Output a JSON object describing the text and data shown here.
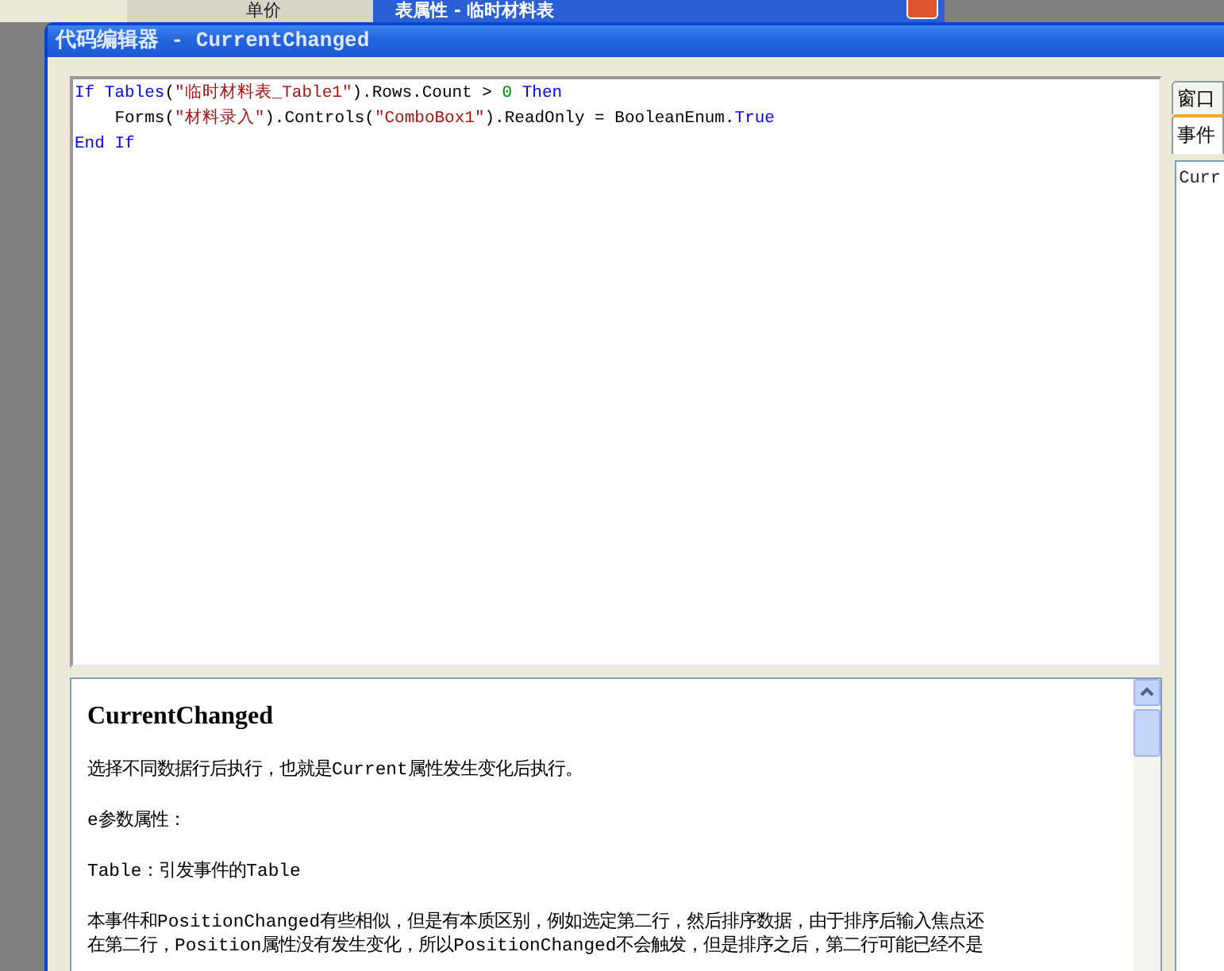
{
  "background": {
    "column_header": "单价",
    "window_title": "表属性 - 临时材料表"
  },
  "window": {
    "title": "代码编辑器 - CurrentChanged"
  },
  "code": [
    [
      {
        "kind": "keyword",
        "text": "If"
      },
      {
        "kind": "keyword",
        "text": "Tables",
        "space_before": true
      },
      {
        "kind": "plain",
        "text": "("
      },
      {
        "kind": "string",
        "text": "\"临时材料表_Table1\""
      },
      {
        "kind": "plain",
        "text": ").Rows.Count > "
      },
      {
        "kind": "number",
        "text": "0"
      },
      {
        "kind": "keyword",
        "text": "Then",
        "space_before": true
      }
    ],
    [
      {
        "kind": "plain",
        "text": "    Forms("
      },
      {
        "kind": "string",
        "text": "\"材料录入\""
      },
      {
        "kind": "plain",
        "text": ").Controls("
      },
      {
        "kind": "string",
        "text": "\"ComboBox1\""
      },
      {
        "kind": "plain",
        "text": ").ReadOnly = BooleanEnum."
      },
      {
        "kind": "keyword",
        "text": "True"
      }
    ],
    [
      {
        "kind": "keyword",
        "text": "End If"
      }
    ]
  ],
  "help": {
    "heading": "CurrentChanged",
    "paragraphs": [
      [
        "选择不同数据行后执行，也就是Current属性发生变化后执行。"
      ],
      [
        "e参数属性："
      ],
      [
        "Table：引发事件的Table"
      ],
      [
        "本事件和PositionChanged有些相似，但是有本质区别，例如选定第二行，然后排序数据，由于排序后输入焦点还",
        "在第二行，Position属性没有发生变化，所以PositionChanged不会触发，但是排序之后，第二行可能已经不是"
      ]
    ]
  },
  "side_panel": {
    "tabs": [
      {
        "label": "窗口",
        "selected": false
      },
      {
        "label": "事件",
        "selected": true
      }
    ],
    "list": [
      "Curr"
    ]
  }
}
